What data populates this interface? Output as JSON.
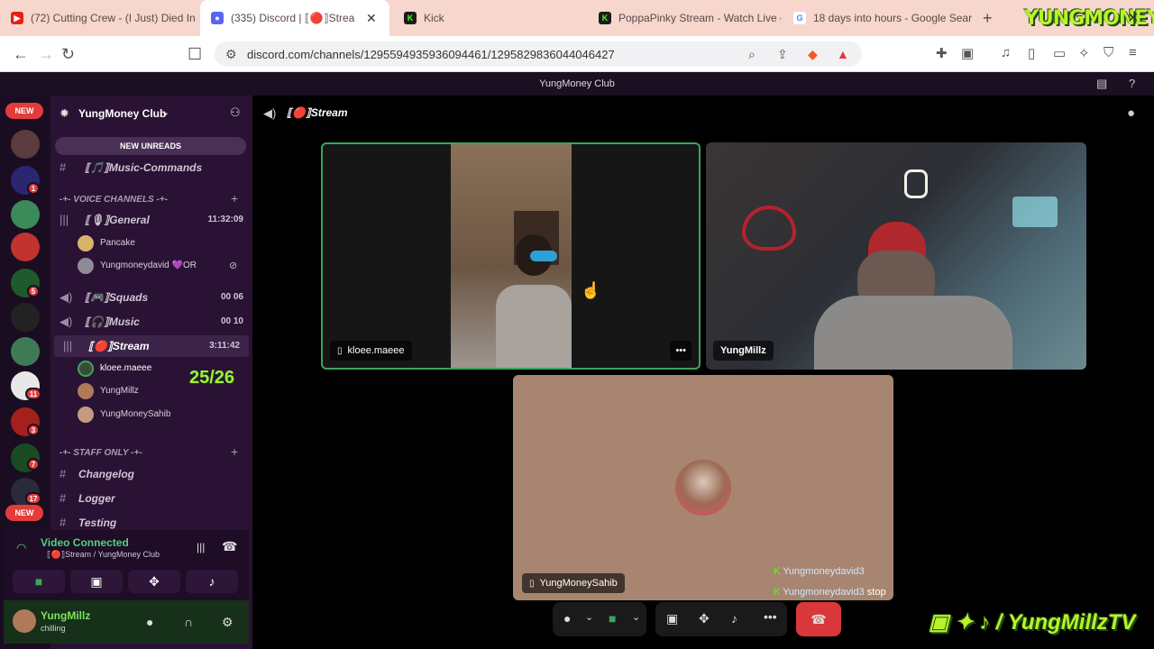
{
  "browser": {
    "tabs": [
      {
        "title": "(72) Cutting Crew - (I Just) Died In",
        "icon": "youtube-icon"
      },
      {
        "title": "(335) Discord | ⟦🔴⟧Strea",
        "icon": "discord-icon"
      },
      {
        "title": "Kick",
        "icon": "kick-icon"
      },
      {
        "title": "PoppaPinky Stream - Watch Live o",
        "icon": "kick-icon"
      },
      {
        "title": "18 days into hours - Google Searc",
        "icon": "google-icon"
      }
    ],
    "url": "discord.com/channels/1295594935936094461/1295829836044046427",
    "brand_logo": "YUNGMONEY"
  },
  "discord": {
    "window_title": "YungMoney Club",
    "server_name": "YungMoney Club",
    "new_unreads": "NEW UNREADS",
    "text_channel_top": "⟦🎵⟧Music-Commands",
    "voice_category": "-+- VOICE CHANNELS -+-",
    "staff_category": "-+- STAFF ONLY -+-",
    "voice_channels": [
      {
        "name": "⟦🎙⟧General",
        "right": "11:32:09"
      },
      {
        "name": "⟦🎮⟧Squads",
        "right": "00  06"
      },
      {
        "name": "⟦🎧⟧Music",
        "right": "00  10"
      },
      {
        "name": "⟦🔴⟧Stream",
        "right": "3:11:42"
      }
    ],
    "general_users": [
      "Pancake",
      "Yungmoneydavid 💜OR"
    ],
    "stream_users": [
      "kloee.maeee",
      "YungMillz",
      "YungMoneySahib"
    ],
    "staff_channels": [
      "Changelog",
      "Logger",
      "Testing"
    ],
    "guild_badges": [
      "1",
      "5",
      "11",
      "3",
      "7",
      "17"
    ],
    "new_pill": "NEW",
    "overlay_count": "25/26",
    "voice_connected": "Video Connected",
    "voice_sub": "⟦🔴⟧Stream / YungMoney Club",
    "user": {
      "name": "YungMillz",
      "status": "chilling"
    },
    "channel_title": "⟦🔴⟧Stream",
    "tiles": [
      {
        "label": "kloee.maeee"
      },
      {
        "label": "YungMillz"
      },
      {
        "label": "YungMoneySahib"
      }
    ],
    "chat": [
      {
        "user": "Yungmoneydavid3",
        "text": ""
      },
      {
        "user": "Yungmoneydavid3",
        "text": "stop"
      }
    ],
    "social_banner": "/ YungMillzTV"
  },
  "colors": {
    "accent": "#5865f2",
    "connected": "#4fd47a",
    "hangup": "#da373c",
    "highlight": "#9cf03a"
  }
}
